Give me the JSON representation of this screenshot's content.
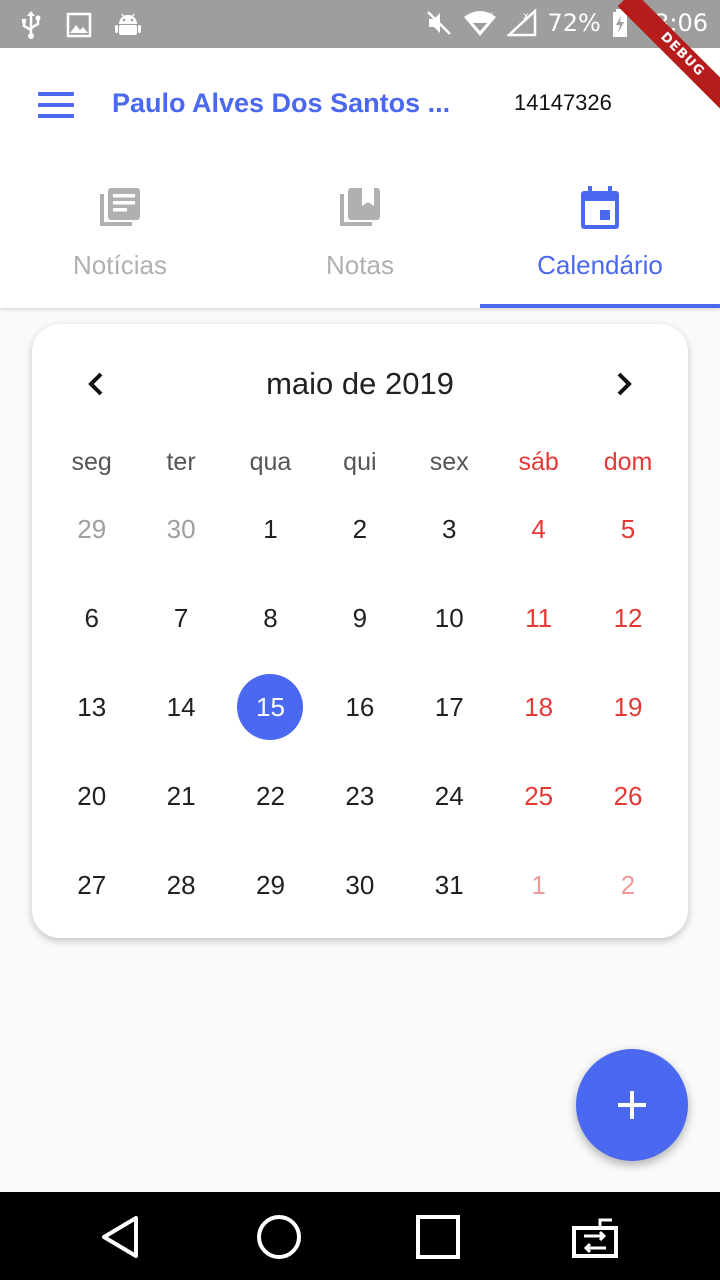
{
  "status_bar": {
    "battery": "72%",
    "time": "03:06",
    "icons": [
      "usb-icon",
      "image-icon",
      "android-icon",
      "mute-icon",
      "wifi-icon",
      "signal-icon",
      "battery-charging-icon"
    ]
  },
  "debug_banner": "DEBUG",
  "app_bar": {
    "user_name": "Paulo Alves Dos Santos ...",
    "user_id": "14147326",
    "menu_icon": "menu-icon"
  },
  "tabs": [
    {
      "label": "Notícias",
      "icon": "news-icon",
      "active": false
    },
    {
      "label": "Notas",
      "icon": "notes-icon",
      "active": false
    },
    {
      "label": "Calendário",
      "icon": "calendar-icon",
      "active": true
    }
  ],
  "calendar": {
    "month_title": "maio de 2019",
    "weekdays": [
      "seg",
      "ter",
      "qua",
      "qui",
      "sex",
      "sáb",
      "dom"
    ],
    "weeks": [
      [
        "29",
        "30",
        "1",
        "2",
        "3",
        "4",
        "5"
      ],
      [
        "6",
        "7",
        "8",
        "9",
        "10",
        "11",
        "12"
      ],
      [
        "13",
        "14",
        "15",
        "16",
        "17",
        "18",
        "19"
      ],
      [
        "20",
        "21",
        "22",
        "23",
        "24",
        "25",
        "26"
      ],
      [
        "27",
        "28",
        "29",
        "30",
        "31",
        "1",
        "2"
      ]
    ],
    "selected_day": "15"
  },
  "colors": {
    "accent": "#4a69f0",
    "weekend": "#e53935",
    "status_bar": "#9e9e9e"
  },
  "nav_bar": {
    "icons": [
      "back-icon",
      "home-icon",
      "recents-icon",
      "screen-rotate-icon"
    ]
  }
}
